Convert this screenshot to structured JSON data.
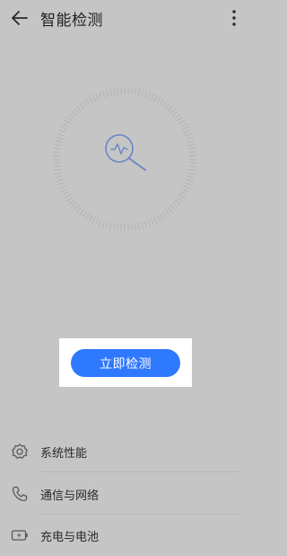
{
  "header": {
    "title": "智能检测"
  },
  "icons": {
    "back": "back-arrow-icon",
    "more": "more-vertical-icon",
    "scan": "magnifier-pulse-icon",
    "system": "gear-icon",
    "network": "phone-icon",
    "battery": "battery-charging-icon"
  },
  "main": {
    "detect_button_label": "立即检测"
  },
  "list": {
    "items": [
      {
        "label": "系统性能"
      },
      {
        "label": "通信与网络"
      },
      {
        "label": "充电与电池"
      }
    ]
  },
  "colors": {
    "accent": "#2f79ff",
    "dimmed_background": "#c5c5c5"
  }
}
